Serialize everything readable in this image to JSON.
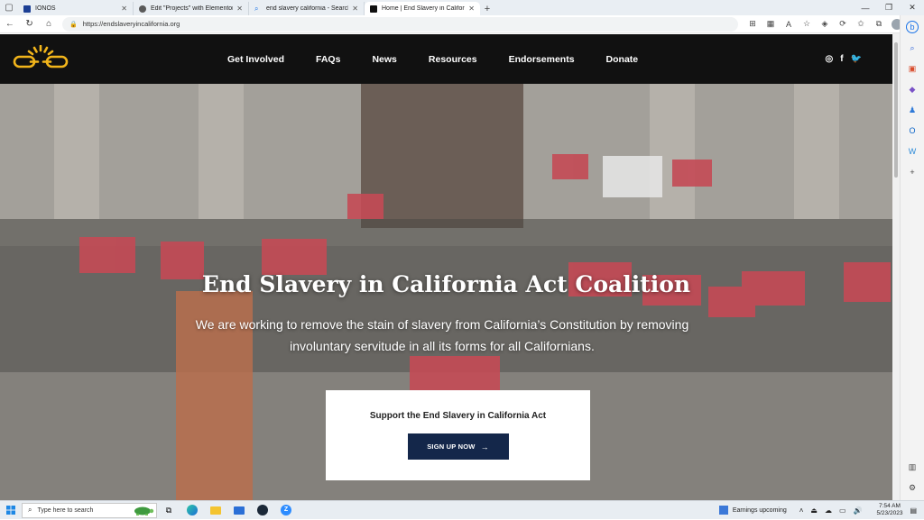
{
  "browser": {
    "tabs": [
      {
        "title": "IONOS",
        "active": false
      },
      {
        "title": "Edit \"Projects\" with Elementor",
        "active": false
      },
      {
        "title": "end slavery california - Search",
        "active": false
      },
      {
        "title": "Home | End Slavery in California",
        "active": true
      }
    ],
    "url": "https://endslaveryincalifornia.org"
  },
  "site": {
    "nav": [
      "Get Involved",
      "FAQs",
      "News",
      "Resources",
      "Endorsements",
      "Donate"
    ],
    "social": [
      "instagram-icon",
      "facebook-icon",
      "twitter-icon"
    ]
  },
  "hero": {
    "title": "End Slavery in California Act Coalition",
    "subtitle": "We are working to remove the stain of slavery from California’s Constitution by removing involuntary servitude in all its forms for all Californians.",
    "cta_title": "Support the End Slavery in California Act",
    "cta_button": "SIGN UP NOW"
  },
  "colors": {
    "header_bg": "#111111",
    "button_bg": "#14274a",
    "logo": "#f2b51b"
  },
  "taskbar": {
    "search_placeholder": "Type here to search",
    "weather": "Earnings upcoming",
    "time": "7:54 AM",
    "date": "5/23/2023"
  }
}
